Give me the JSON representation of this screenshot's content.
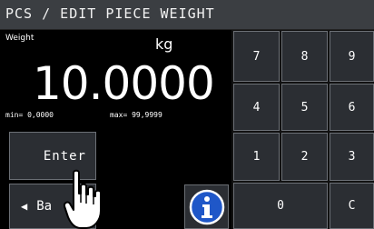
{
  "header": {
    "title": "PCS / EDIT PIECE WEIGHT"
  },
  "display": {
    "label": "Weight",
    "unit": "kg",
    "value": "10.0000",
    "min": "min= 0,0000",
    "max": "max= 99,9999"
  },
  "buttons": {
    "enter": "Enter",
    "back": "Ba"
  },
  "keypad": {
    "k7": "7",
    "k8": "8",
    "k9": "9",
    "k4": "4",
    "k5": "5",
    "k6": "6",
    "k1": "1",
    "k2": "2",
    "k3": "3",
    "k0": "0",
    "kc": "C"
  },
  "icons": {
    "info": "info-icon",
    "back_arrow": "left-arrow-icon",
    "pointer": "hand-pointer-icon"
  },
  "colors": {
    "title_bar": "#3b3e42",
    "button": "#2b2e33",
    "info": "#1f57c8"
  }
}
